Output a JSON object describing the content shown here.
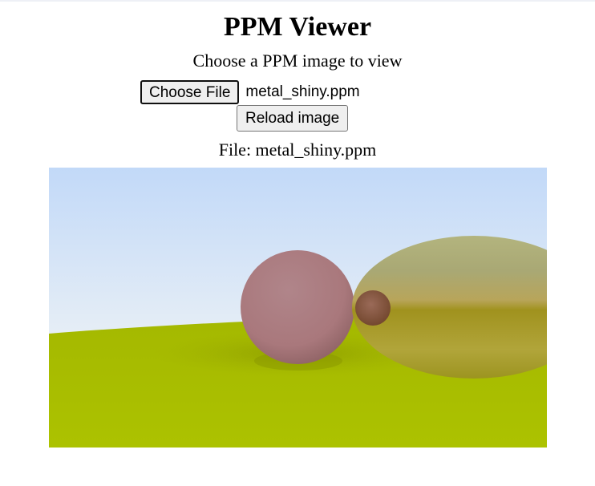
{
  "header": {
    "title": "PPM Viewer",
    "subtitle": "Choose a PPM image to view"
  },
  "file_picker": {
    "button_label": "Choose File",
    "selected_file": "metal_shiny.ppm"
  },
  "reload_button": {
    "label": "Reload image"
  },
  "file_info": {
    "label": "File: metal_shiny.ppm"
  },
  "image": {
    "sky_top": "#c2d9f8",
    "sky_bottom": "#e6eef6",
    "ground": "#acc200",
    "ground_shadow": "#9aaa05",
    "sphere_pink": "#a9787c",
    "sphere_metal": "#b8a55a"
  }
}
